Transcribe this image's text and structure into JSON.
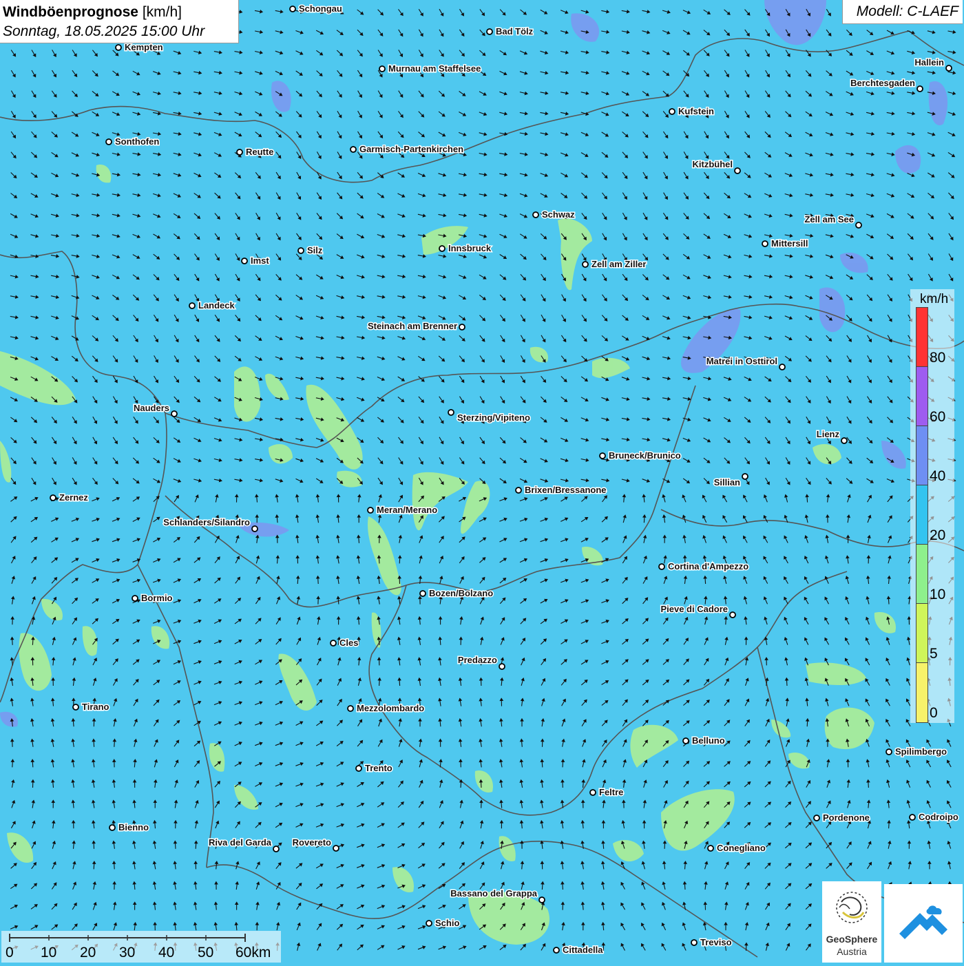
{
  "header": {
    "title_bold": "Windböenprognose",
    "title_unit": "[km/h]",
    "datetime": "Sonntag, 18.05.2025 15:00 Uhr"
  },
  "model": {
    "label": "Modell: C-LAEF"
  },
  "legend": {
    "unit": "km/h",
    "bins": [
      {
        "label": "80",
        "color": "#ff3333"
      },
      {
        "label": "60",
        "color": "#9e5cf0"
      },
      {
        "label": "40",
        "color": "#6e8ff3"
      },
      {
        "label": "20",
        "color": "#33c4f0"
      },
      {
        "label": "10",
        "color": "#8ef08c"
      },
      {
        "label": "5",
        "color": "#cff55a"
      },
      {
        "label": "0",
        "color": "#f7f26a"
      }
    ]
  },
  "scale_bar": {
    "ticks": [
      "0",
      "10",
      "20",
      "30",
      "40",
      "50",
      "60km"
    ]
  },
  "logos": {
    "geosphere_name": "GeoSphere",
    "geosphere_sub": "Austria"
  },
  "colors": {
    "background": "#4fc8ef",
    "calm_patch": "#a8ec9a",
    "strong_patch": "#7d96f0",
    "border_line": "#555555"
  },
  "cities": [
    {
      "name": "Schongau",
      "dot": [
        425,
        13
      ],
      "label": [
        434,
        13
      ],
      "anchor": "start"
    },
    {
      "name": "Bad Tölz",
      "dot": [
        711,
        46
      ],
      "label": [
        720,
        46
      ],
      "anchor": "start"
    },
    {
      "name": "Kempten",
      "dot": [
        172,
        69
      ],
      "label": [
        181,
        69
      ],
      "anchor": "start"
    },
    {
      "name": "Murnau am Staffelsee",
      "dot": [
        555,
        100
      ],
      "label": [
        564,
        100
      ],
      "anchor": "start"
    },
    {
      "name": "Hallein",
      "dot": [
        1378,
        99
      ],
      "label": [
        1371,
        91
      ],
      "anchor": "end"
    },
    {
      "name": "Berchtesgaden",
      "dot": [
        1336,
        129
      ],
      "label": [
        1329,
        121
      ],
      "anchor": "end"
    },
    {
      "name": "Kufstein",
      "dot": [
        976,
        162
      ],
      "label": [
        985,
        162
      ],
      "anchor": "start"
    },
    {
      "name": "Sonthofen",
      "dot": [
        158,
        206
      ],
      "label": [
        167,
        206
      ],
      "anchor": "start"
    },
    {
      "name": "Reutte",
      "dot": [
        348,
        221
      ],
      "label": [
        357,
        221
      ],
      "anchor": "start"
    },
    {
      "name": "Garmisch-Partenkirchen",
      "dot": [
        513,
        217
      ],
      "label": [
        522,
        217
      ],
      "anchor": "start"
    },
    {
      "name": "Kitzbühel",
      "dot": [
        1071,
        248
      ],
      "label": [
        1064,
        239
      ],
      "anchor": "end"
    },
    {
      "name": "Schwaz",
      "dot": [
        778,
        312
      ],
      "label": [
        787,
        312
      ],
      "anchor": "start"
    },
    {
      "name": "Zell am See",
      "dot": [
        1247,
        327
      ],
      "label": [
        1240,
        319
      ],
      "anchor": "end"
    },
    {
      "name": "Mittersill",
      "dot": [
        1111,
        354
      ],
      "label": [
        1120,
        354
      ],
      "anchor": "start"
    },
    {
      "name": "Innsbruck",
      "dot": [
        642,
        361
      ],
      "label": [
        651,
        361
      ],
      "anchor": "start"
    },
    {
      "name": "Silz",
      "dot": [
        437,
        364
      ],
      "label": [
        446,
        364
      ],
      "anchor": "start"
    },
    {
      "name": "Imst",
      "dot": [
        355,
        379
      ],
      "label": [
        364,
        379
      ],
      "anchor": "start"
    },
    {
      "name": "Zell am Ziller",
      "dot": [
        850,
        384
      ],
      "label": [
        859,
        384
      ],
      "anchor": "start"
    },
    {
      "name": "Landeck",
      "dot": [
        279,
        444
      ],
      "label": [
        288,
        444
      ],
      "anchor": "start"
    },
    {
      "name": "Steinach am Brenner",
      "dot": [
        671,
        475
      ],
      "label": [
        664,
        474
      ],
      "anchor": "end"
    },
    {
      "name": "Matrei in Osttirol",
      "dot": [
        1136,
        533
      ],
      "label": [
        1129,
        525
      ],
      "anchor": "end"
    },
    {
      "name": "Nauders",
      "dot": [
        253,
        601
      ],
      "label": [
        246,
        593
      ],
      "anchor": "end"
    },
    {
      "name": "Sterzing/Vipiteno",
      "dot": [
        655,
        599
      ],
      "label": [
        664,
        607
      ],
      "anchor": "start"
    },
    {
      "name": "Lienz",
      "dot": [
        1226,
        640
      ],
      "label": [
        1219,
        631
      ],
      "anchor": "end"
    },
    {
      "name": "Bruneck/Brunico",
      "dot": [
        875,
        662
      ],
      "label": [
        884,
        662
      ],
      "anchor": "start"
    },
    {
      "name": "Sillian",
      "dot": [
        1082,
        692
      ],
      "label": [
        1075,
        701
      ],
      "anchor": "end"
    },
    {
      "name": "Brixen/Bressanone",
      "dot": [
        753,
        712
      ],
      "label": [
        762,
        712
      ],
      "anchor": "start"
    },
    {
      "name": "Zernez",
      "dot": [
        77,
        723
      ],
      "label": [
        86,
        723
      ],
      "anchor": "start"
    },
    {
      "name": "Meran/Merano",
      "dot": [
        538,
        741
      ],
      "label": [
        547,
        741
      ],
      "anchor": "start"
    },
    {
      "name": "Schlanders/Silandro",
      "dot": [
        370,
        768
      ],
      "label": [
        363,
        759
      ],
      "anchor": "end"
    },
    {
      "name": "Cortina d'Ampezzo",
      "dot": [
        961,
        823
      ],
      "label": [
        970,
        823
      ],
      "anchor": "start"
    },
    {
      "name": "Bozen/Bolzano",
      "dot": [
        614,
        862
      ],
      "label": [
        623,
        862
      ],
      "anchor": "start"
    },
    {
      "name": "Bormio",
      "dot": [
        196,
        869
      ],
      "label": [
        205,
        869
      ],
      "anchor": "start"
    },
    {
      "name": "Pieve di Cadore",
      "dot": [
        1064,
        893
      ],
      "label": [
        1057,
        885
      ],
      "anchor": "end"
    },
    {
      "name": "Cles",
      "dot": [
        484,
        934
      ],
      "label": [
        493,
        934
      ],
      "anchor": "start"
    },
    {
      "name": "Predazzo",
      "dot": [
        729,
        968
      ],
      "label": [
        722,
        959
      ],
      "anchor": "end"
    },
    {
      "name": "Tirano",
      "dot": [
        110,
        1027
      ],
      "label": [
        119,
        1027
      ],
      "anchor": "start"
    },
    {
      "name": "Mezzolombardo",
      "dot": [
        509,
        1029
      ],
      "label": [
        518,
        1029
      ],
      "anchor": "start"
    },
    {
      "name": "Belluno",
      "dot": [
        996,
        1076
      ],
      "label": [
        1005,
        1076
      ],
      "anchor": "start"
    },
    {
      "name": "Spilimbergo",
      "dot": [
        1291,
        1092
      ],
      "label": [
        1300,
        1092
      ],
      "anchor": "start"
    },
    {
      "name": "Trento",
      "dot": [
        521,
        1116
      ],
      "label": [
        530,
        1116
      ],
      "anchor": "start"
    },
    {
      "name": "Feltre",
      "dot": [
        861,
        1151
      ],
      "label": [
        870,
        1151
      ],
      "anchor": "start"
    },
    {
      "name": "Pordenone",
      "dot": [
        1186,
        1188
      ],
      "label": [
        1195,
        1188
      ],
      "anchor": "start"
    },
    {
      "name": "Codroipo",
      "dot": [
        1325,
        1187
      ],
      "label": [
        1334,
        1187
      ],
      "anchor": "start"
    },
    {
      "name": "Bienno",
      "dot": [
        163,
        1202
      ],
      "label": [
        172,
        1202
      ],
      "anchor": "start"
    },
    {
      "name": "Riva del Garda",
      "dot": [
        401,
        1233
      ],
      "label": [
        394,
        1224
      ],
      "anchor": "end"
    },
    {
      "name": "Rovereto",
      "dot": [
        488,
        1232
      ],
      "label": [
        481,
        1224
      ],
      "anchor": "end"
    },
    {
      "name": "Conegliano",
      "dot": [
        1032,
        1232
      ],
      "label": [
        1041,
        1232
      ],
      "anchor": "start"
    },
    {
      "name": "Bassano del Grappa",
      "dot": [
        787,
        1307
      ],
      "label": [
        780,
        1298
      ],
      "anchor": "end"
    },
    {
      "name": "Schio",
      "dot": [
        623,
        1341
      ],
      "label": [
        632,
        1341
      ],
      "anchor": "start"
    },
    {
      "name": "Treviso",
      "dot": [
        1008,
        1369
      ],
      "label": [
        1017,
        1369
      ],
      "anchor": "start"
    },
    {
      "name": "Cittadella",
      "dot": [
        808,
        1380
      ],
      "label": [
        817,
        1380
      ],
      "anchor": "start"
    }
  ]
}
